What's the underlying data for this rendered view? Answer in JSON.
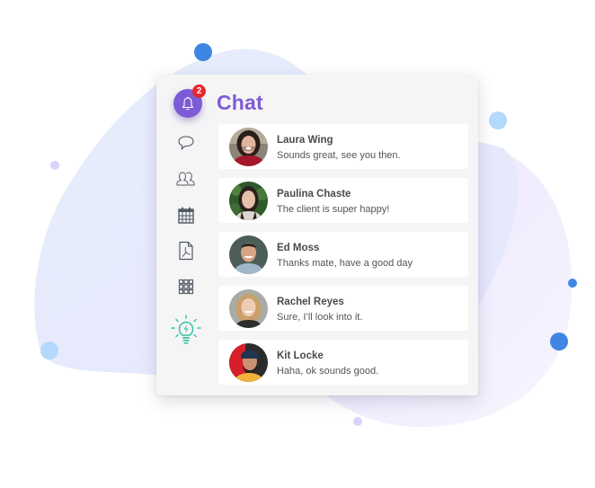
{
  "header": {
    "title": "Chat"
  },
  "notifications": {
    "icon": "bell-icon",
    "badge_count": "2"
  },
  "sidebar": {
    "items": [
      {
        "name": "chat",
        "icon": "speech-bubble-icon"
      },
      {
        "name": "contacts",
        "icon": "users-icon"
      },
      {
        "name": "calendar",
        "icon": "calendar-icon"
      },
      {
        "name": "pdf-documents",
        "icon": "pdf-file-icon"
      },
      {
        "name": "apps",
        "icon": "grid-icon"
      },
      {
        "name": "ideas",
        "icon": "lightbulb-icon"
      }
    ]
  },
  "conversations": [
    {
      "name": "Laura Wing",
      "message": "Sounds great, see you then."
    },
    {
      "name": "Paulina Chaste",
      "message": "The client is super happy!"
    },
    {
      "name": "Ed Moss",
      "message": "Thanks mate, have a good day"
    },
    {
      "name": "Rachel Reyes",
      "message": "Sure, I’ll look into it."
    },
    {
      "name": "Kit Locke",
      "message": "Haha, ok sounds good."
    }
  ],
  "colors": {
    "accent": "#7d5bd6",
    "badge": "#e8262b",
    "idea_icon": "#3cc2a8",
    "icon_gray": "#4f5a66",
    "blob_blue": "#e4ecfd",
    "blob_purple": "#ebe6fd",
    "dot_blue": "#3f86e4",
    "dot_light_blue": "#b3d9fc",
    "dot_lavender": "#dcd3fb"
  }
}
